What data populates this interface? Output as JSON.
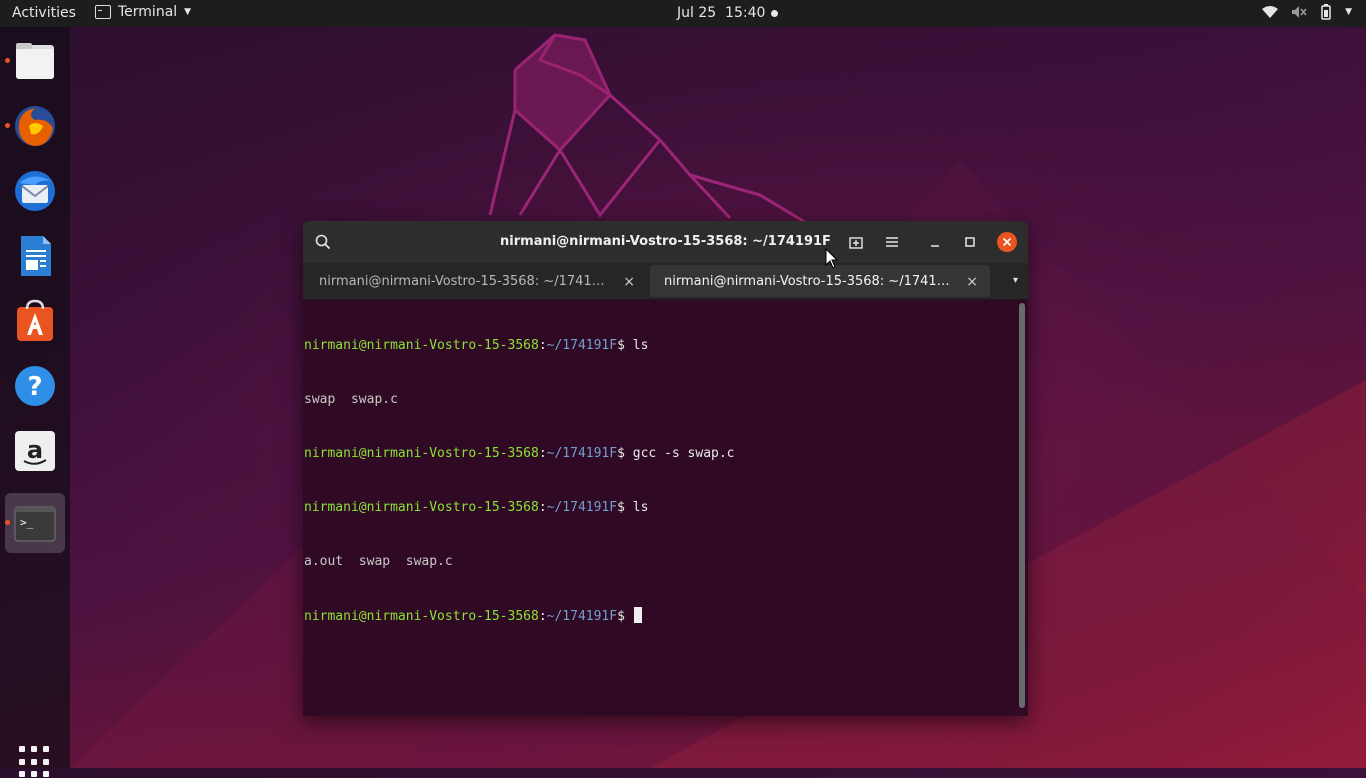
{
  "topbar": {
    "activities": "Activities",
    "app_name": "Terminal",
    "clock": "Jul 25  15:40",
    "icons": [
      "wifi-icon",
      "volume-muted-icon",
      "battery-icon",
      "power-menu-caret-icon"
    ]
  },
  "dock": {
    "items": [
      {
        "name": "files",
        "icon": "folder-icon",
        "running": true
      },
      {
        "name": "firefox",
        "icon": "firefox-icon",
        "running": true
      },
      {
        "name": "thunderbird",
        "icon": "thunderbird-icon",
        "running": false
      },
      {
        "name": "libreoffice-writer",
        "icon": "writer-icon",
        "running": false
      },
      {
        "name": "ubuntu-software",
        "icon": "software-center-icon",
        "running": false
      },
      {
        "name": "help",
        "icon": "help-icon",
        "running": false
      },
      {
        "name": "amazon",
        "icon": "amazon-icon",
        "running": false
      },
      {
        "name": "terminal",
        "icon": "terminal-icon",
        "running": true,
        "active": true
      }
    ],
    "show_apps_icon": "app-grid-icon"
  },
  "window": {
    "title": "nirmani@nirmani-Vostro-15-3568: ~/174191F",
    "tabs": [
      {
        "label": "nirmani@nirmani-Vostro-15-3568: ~/1741…",
        "close": "×",
        "active": false
      },
      {
        "label": "nirmani@nirmani-Vostro-15-3568: ~/1741…",
        "close": "×",
        "active": true
      }
    ],
    "tab_menu": "▾"
  },
  "terminal": {
    "user_host": "nirmani@nirmani-Vostro-15-3568",
    "path": "~/174191F",
    "lines": [
      {
        "type": "prompt",
        "cmd": "ls"
      },
      {
        "type": "output",
        "text": "swap  swap.c"
      },
      {
        "type": "prompt",
        "cmd": "gcc -s swap.c"
      },
      {
        "type": "prompt",
        "cmd": "ls"
      },
      {
        "type": "output",
        "text": "a.out  swap  swap.c"
      },
      {
        "type": "prompt",
        "cmd": ""
      }
    ]
  },
  "colors": {
    "terminal_bg": "#300a24",
    "prompt_user": "#8ae234",
    "prompt_path": "#729fcf",
    "close_button": "#e95420",
    "headerbar": "#2d2d2d"
  }
}
